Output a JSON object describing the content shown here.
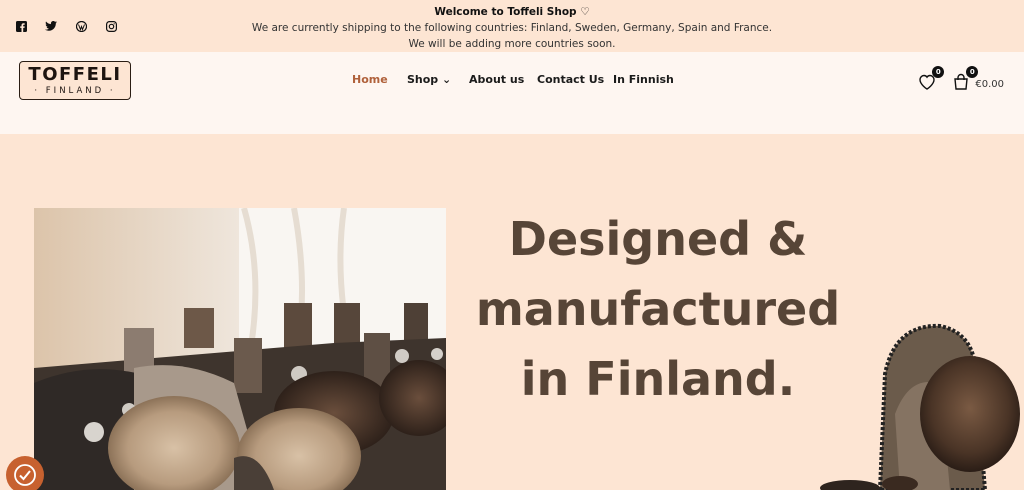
{
  "topbar": {
    "social_icons": [
      "facebook-icon",
      "twitter-icon",
      "wordpress-icon",
      "instagram-icon"
    ],
    "welcome": "Welcome to Toffeli Shop ♡",
    "line1": "We are currently shipping to the following countries: Finland, Sweden, Germany, Spain and France.",
    "line2": "We will be adding more countries soon."
  },
  "header": {
    "logo_main": "TOFFELI",
    "logo_sub": "· FINLAND ·",
    "nav": [
      {
        "label": "Home",
        "active": true
      },
      {
        "label": "Shop ⌄",
        "active": false
      },
      {
        "label": "About us",
        "active": false
      },
      {
        "label": "Contact Us",
        "active": false
      },
      {
        "label": "In Finnish",
        "active": false
      }
    ],
    "wishlist_count": "0",
    "cart_count": "0",
    "cart_total": "€0.00"
  },
  "hero": {
    "headline_1": "Designed &",
    "headline_2": "manufactured",
    "headline_3": "in Finland."
  },
  "colors": {
    "background": "#fde5d3",
    "header_bg": "#fef6f1",
    "accent": "#b0613b",
    "headline": "#574537",
    "cookie_button": "#c7612f"
  }
}
